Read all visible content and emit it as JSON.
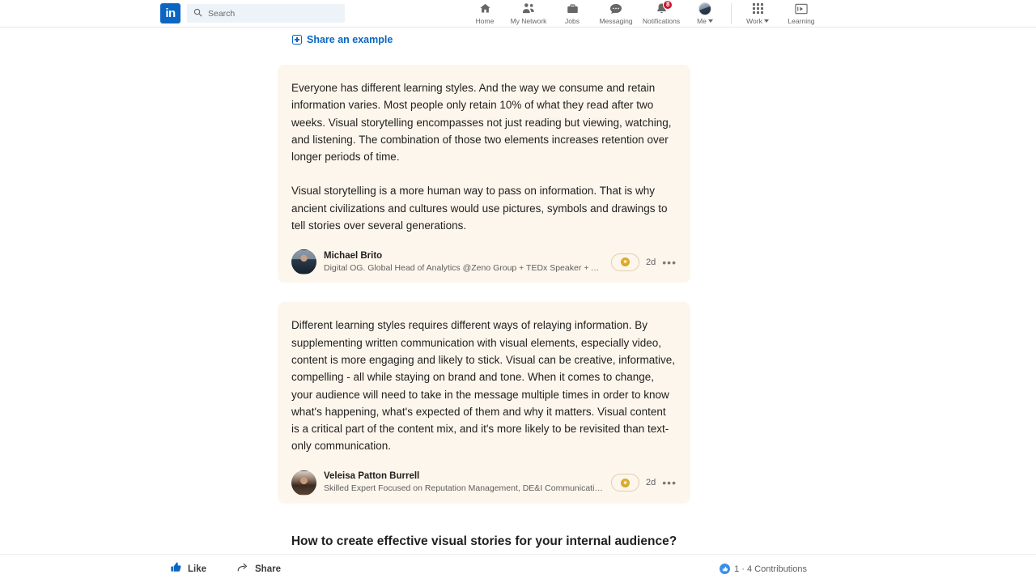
{
  "nav": {
    "logo_text": "in",
    "search": {
      "placeholder": "Search",
      "value": "",
      "icon": "search-icon"
    },
    "items": [
      {
        "label": "Home",
        "icon": "home-icon",
        "badge": ""
      },
      {
        "label": "My Network",
        "icon": "people-icon",
        "badge": ""
      },
      {
        "label": "Jobs",
        "icon": "briefcase-icon",
        "badge": ""
      },
      {
        "label": "Messaging",
        "icon": "message-bubble-icon",
        "badge": ""
      },
      {
        "label": "Notifications",
        "icon": "bell-icon",
        "badge": "8"
      },
      {
        "label": "Me",
        "icon": "avatar-icon",
        "badge": "",
        "caret": true
      },
      {
        "label": "Work",
        "icon": "grid-icon",
        "badge": "",
        "caret": true
      },
      {
        "label": "Learning",
        "icon": "learning-icon",
        "badge": ""
      }
    ]
  },
  "share": {
    "label": "Share an example",
    "icon": "plus-square-icon"
  },
  "contributions": [
    {
      "paragraphs": [
        "Everyone has different learning styles. And the way we consume and retain information varies. Most people only retain 10% of what they read after two weeks. Visual storytelling encompasses not just reading but viewing, watching, and listening. The combination of those two elements increases retention over longer periods of time.",
        "Visual storytelling is a more human way to pass on information. That is why ancient civilizations and cultures would use pictures, symbols and drawings to tell stories over several generations."
      ],
      "author": {
        "name": "Michael Brito",
        "headline": "Digital OG. Global Head of Analytics @Zeno Group + TEDx Speaker + Adj…",
        "avatar": "michael-brito-avatar"
      },
      "badge_icon": "top-contributor-award-icon",
      "time_ago": "2d",
      "menu_icon": "more-options-icon"
    },
    {
      "paragraphs": [
        "Different learning styles requires different ways of relaying information. By supplementing written communication with visual elements, especially video, content is more engaging and likely to stick. Visual can be creative, informative, compelling - all while staying on brand and tone. When it comes to change, your audience will need to take in the message multiple times in order to know what's happening, what's expected of them and why it matters. Visual content is a critical part of the content mix, and it's more likely to be revisited than text-only communication."
      ],
      "author": {
        "name": "Veleisa Patton Burrell",
        "headline": "Skilled Expert Focused on Reputation Management, DE&I Communicatio…",
        "avatar": "veleisa-patton-burrell-avatar"
      },
      "badge_icon": "top-contributor-award-icon",
      "time_ago": "2d",
      "menu_icon": "more-options-icon"
    }
  ],
  "next_section": {
    "heading": "How to create effective visual stories for your internal audience?"
  },
  "bottom_bar": {
    "like_label": "Like",
    "like_icon": "thumbs-up-icon",
    "share_label": "Share",
    "share_icon": "share-arrow-icon",
    "reaction_icon": "like-reaction-icon",
    "contributions_count": "1 · 4 Contributions"
  },
  "colors": {
    "brand_blue": "#0a66c2",
    "card_cream": "#fdf6ec",
    "badge_red": "#cb112d",
    "reaction_blue": "#378fe9",
    "award_gold": "#e8b730"
  }
}
